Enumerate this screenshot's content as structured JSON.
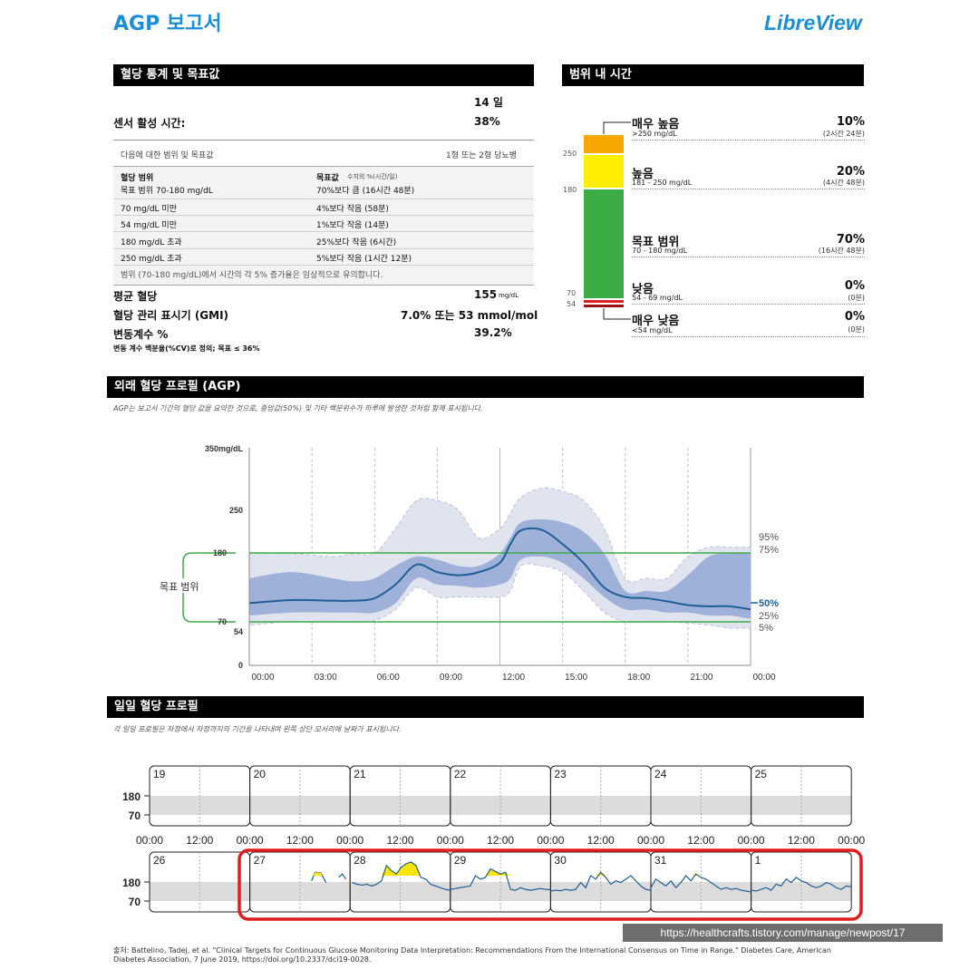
{
  "header": {
    "title": "AGP 보고서",
    "brand": "LibreView"
  },
  "stats": {
    "section_title": "혈당 통계 및 목표값",
    "days": "14 일",
    "sensor_label": "센서 활성 시간:",
    "sensor_value": "38%",
    "targets_for": "다음에 대한 범위 및 목표값",
    "diabetes_type": "1형 또는 2형 당뇨병",
    "col1_header": "혈당 범위",
    "col2_header": "목표값",
    "col2_sub": "수치의 %(시간/일)",
    "rows": [
      {
        "range": "목표 범위 70-180 mg/dL",
        "goal": "70%보다 큼 (16시간 48분)"
      },
      {
        "range": "70 mg/dL 미만",
        "goal": "4%보다 작음 (58분)"
      },
      {
        "range": "54 mg/dL 미만",
        "goal": "1%보다 작음 (14분)"
      },
      {
        "range": "180 mg/dL 초과",
        "goal": "25%보다 작음 (6시간)"
      },
      {
        "range": "250 mg/dL 초과",
        "goal": "5%보다 작음 (1시간 12분)"
      }
    ],
    "note": "범위 (70-180 mg/dL)에서 시간의 각 5% 증가율은 임상적으로 유의합니다.",
    "avg_label": "평균 혈당",
    "avg_value": "155",
    "avg_unit": "mg/dL",
    "gmi_label": "혈당 관리 표시기 (GMI)",
    "gmi_value": "7.0% 또는 53 mmol/mol",
    "cv_label": "변동계수 %",
    "cv_value": "39.2%",
    "cv_note": "변동 계수 백분율(%CV)로 정의; 목표 ≤ 36%"
  },
  "tir": {
    "section_title": "범위 내 시간",
    "axis": [
      "250",
      "180",
      "70",
      "54"
    ],
    "items": [
      {
        "label": "매우 높음",
        "sub": ">250 mg/dL",
        "pct": "10%",
        "time": "(2시간 24분)",
        "color": "#f7a800"
      },
      {
        "label": "높음",
        "sub": "181 - 250 mg/dL",
        "pct": "20%",
        "time": "(4시간 48분)",
        "color": "#ffee00"
      },
      {
        "label": "목표 범위",
        "sub": "70 - 180 mg/dL",
        "pct": "70%",
        "time": "(16시간 48분)",
        "color": "#3cad44"
      },
      {
        "label": "낮음",
        "sub": "54 - 69 mg/dL",
        "pct": "0%",
        "time": "(0분)",
        "color": "#e02020"
      },
      {
        "label": "매우 낮음",
        "sub": "<54 mg/dL",
        "pct": "0%",
        "time": "(0분)",
        "color": "#a01010"
      }
    ]
  },
  "agp": {
    "section_title": "외래 혈당 프로필 (AGP)",
    "description": "AGP는 보고서 기간의 혈당 값을 요약한 것으로, 중앙값(50%) 및 기타 백분위수가 하루에 발생한 것처럼 함께 표시됩니다.",
    "target_label": "목표 범위",
    "y_ticks": [
      "350mg/dL",
      "250",
      "180",
      "70",
      "54",
      "0"
    ],
    "x_ticks": [
      "00:00",
      "03:00",
      "06:00",
      "09:00",
      "12:00",
      "15:00",
      "18:00",
      "21:00",
      "00:00"
    ],
    "percentile_labels": [
      "95%",
      "75%",
      "50%",
      "25%",
      "5%"
    ],
    "colors": {
      "outer": "#dfe4ef",
      "inner": "#9fb1d8",
      "median": "#1f5f96",
      "target": "#3cad44"
    }
  },
  "chart_data": {
    "type": "area",
    "x": [
      0,
      2,
      4,
      5,
      6,
      7,
      8,
      9,
      10,
      11,
      12,
      12.5,
      13,
      14,
      15,
      16,
      17,
      18,
      19,
      20,
      21,
      22,
      23,
      24
    ],
    "xlabel": "",
    "ylabel": "",
    "ylim": [
      0,
      350
    ],
    "series": [
      {
        "name": "95%",
        "values": [
          180,
          180,
          175,
          180,
          180,
          220,
          265,
          265,
          250,
          205,
          220,
          245,
          270,
          285,
          280,
          265,
          220,
          140,
          140,
          140,
          175,
          190,
          190,
          190
        ]
      },
      {
        "name": "75%",
        "values": [
          140,
          150,
          140,
          135,
          140,
          160,
          175,
          170,
          160,
          160,
          180,
          205,
          230,
          235,
          230,
          215,
          180,
          120,
          120,
          120,
          145,
          175,
          180,
          180
        ]
      },
      {
        "name": "50%",
        "values": [
          100,
          105,
          104,
          104,
          108,
          130,
          162,
          150,
          145,
          150,
          165,
          195,
          217,
          218,
          195,
          165,
          125,
          110,
          108,
          103,
          97,
          95,
          95,
          90
        ]
      },
      {
        "name": "25%",
        "values": [
          80,
          85,
          85,
          85,
          85,
          100,
          140,
          130,
          128,
          125,
          130,
          140,
          170,
          175,
          165,
          140,
          110,
          90,
          90,
          85,
          85,
          80,
          80,
          75
        ]
      },
      {
        "name": "5%",
        "values": [
          65,
          70,
          70,
          70,
          72,
          90,
          125,
          110,
          110,
          110,
          110,
          120,
          160,
          160,
          150,
          120,
          85,
          70,
          70,
          70,
          68,
          65,
          60,
          60
        ]
      }
    ]
  },
  "daily": {
    "section_title": "일일 혈당 프로필",
    "description": "각 일일 프로필은 자정에서 자정까지의 기간을 나타내며 왼쪽 상단 모서리에 날짜가 표시됩니다.",
    "row1_days": [
      "19",
      "20",
      "21",
      "22",
      "23",
      "24",
      "25"
    ],
    "row2_days": [
      "26",
      "27",
      "28",
      "29",
      "30",
      "31",
      "1"
    ],
    "y_ticks": [
      "180",
      "70"
    ],
    "x_ticks": [
      "00:00",
      "12:00",
      "00:00",
      "12:00",
      "00:00",
      "12:00",
      "00:00",
      "12:00",
      "00:00",
      "12:00",
      "00:00",
      "12:00",
      "00:00",
      "12:00",
      "00:00"
    ]
  },
  "footer": {
    "citation": "출처: Battelino, Tadej, et al. \"Clinical Targets for Continuous Glucose Monitoring Data Interpretation: Recommendations From the International Consensus on Time in Range.\" Diabetes Care, American Diabetes Association, 7 June 2019, https://doi.org/10.2337/dci19-0028.",
    "watermark": "https://healthcrafts.tistory.com/manage/newpost/17"
  }
}
